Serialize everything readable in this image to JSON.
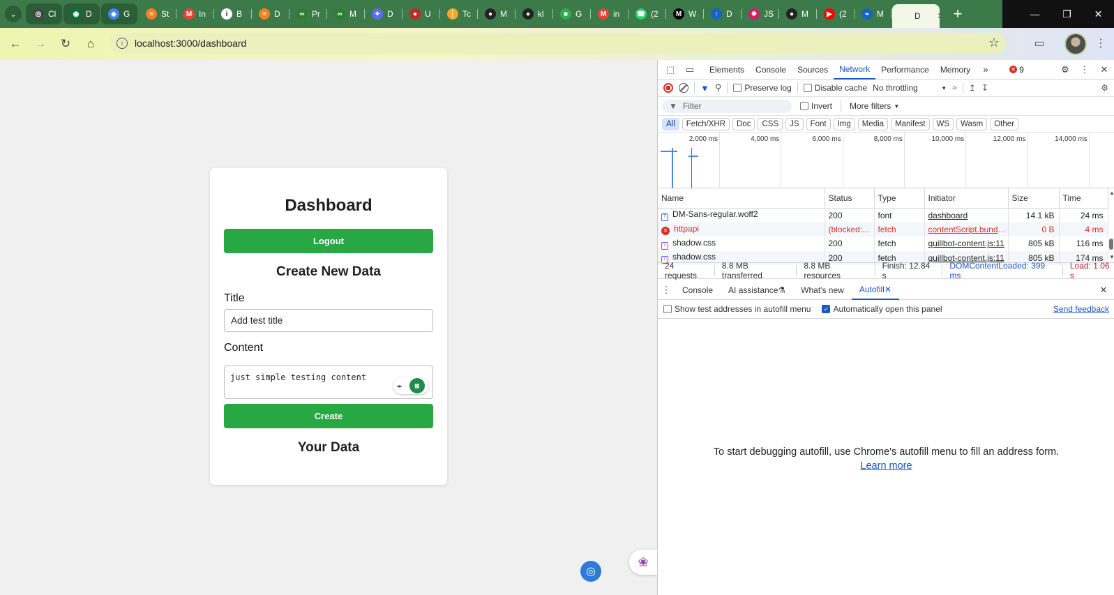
{
  "browser": {
    "tabs": [
      {
        "label": "Cl",
        "color": "#444444",
        "glyph": "◎",
        "pinned": true
      },
      {
        "label": "D",
        "color": "#0b6e3a",
        "glyph": "◉",
        "pinned": true
      },
      {
        "label": "G",
        "color": "#4285f4",
        "glyph": "◆",
        "pinned": true
      },
      {
        "label": "St",
        "color": "#f48024",
        "glyph": "≡"
      },
      {
        "label": "In",
        "color": "#ea4335",
        "glyph": "M"
      },
      {
        "label": "B",
        "color": "#ffffff",
        "glyph": "i"
      },
      {
        "label": "D",
        "color": "#f48024",
        "glyph": "≡"
      },
      {
        "label": "Pr",
        "color": "#2e7d32",
        "glyph": "∞"
      },
      {
        "label": "M",
        "color": "#2e7d32",
        "glyph": "∞"
      },
      {
        "label": "D",
        "color": "#5b6cf0",
        "glyph": "✦"
      },
      {
        "label": "U",
        "color": "#c62828",
        "glyph": "●"
      },
      {
        "label": "Tc",
        "color": "#f9a825",
        "glyph": "│"
      },
      {
        "label": "M",
        "color": "#222222",
        "glyph": "●"
      },
      {
        "label": "kl",
        "color": "#222222",
        "glyph": "●"
      },
      {
        "label": "G",
        "color": "#34a853",
        "glyph": "■"
      },
      {
        "label": "in",
        "color": "#ea4335",
        "glyph": "M"
      },
      {
        "label": "(2",
        "color": "#25d366",
        "glyph": "☎"
      },
      {
        "label": "W",
        "color": "#000000",
        "glyph": "M"
      },
      {
        "label": "D",
        "color": "#1565c0",
        "glyph": "↑"
      },
      {
        "label": "JS",
        "color": "#d81b60",
        "glyph": "✸"
      },
      {
        "label": "M",
        "color": "#222222",
        "glyph": "●"
      },
      {
        "label": "(2",
        "color": "#ff0000",
        "glyph": "▶"
      },
      {
        "label": "M",
        "color": "#1565c0",
        "glyph": "⌁"
      },
      {
        "label": "D",
        "color": "#cccccc",
        "glyph": "",
        "active": true
      }
    ],
    "url": "localhost:3000/dashboard"
  },
  "page": {
    "title": "Dashboard",
    "logout_label": "Logout",
    "create_heading": "Create New Data",
    "title_label": "Title",
    "title_value": "Add test title",
    "content_label": "Content",
    "content_value": "just simple testing content",
    "create_label": "Create",
    "your_data_heading": "Your Data"
  },
  "devtools": {
    "tabs": [
      "Elements",
      "Console",
      "Sources",
      "Network",
      "Performance",
      "Memory"
    ],
    "active_tab": "Network",
    "error_count": "9",
    "toolbar": {
      "preserve_log": "Preserve log",
      "disable_cache": "Disable cache",
      "throttling": "No throttling"
    },
    "filter": {
      "placeholder": "Filter",
      "invert": "Invert",
      "more_filters": "More filters"
    },
    "type_filters": [
      "All",
      "Fetch/XHR",
      "Doc",
      "CSS",
      "JS",
      "Font",
      "Img",
      "Media",
      "Manifest",
      "WS",
      "Wasm",
      "Other"
    ],
    "timeline_ticks": [
      "2,000 ms",
      "4,000 ms",
      "6,000 ms",
      "8,000 ms",
      "10,000 ms",
      "12,000 ms",
      "14,000 ms"
    ],
    "columns": [
      "Name",
      "Status",
      "Type",
      "Initiator",
      "Size",
      "Time"
    ],
    "rows": [
      {
        "name": "DM-Sans-regular.woff2",
        "status": "200",
        "type": "font",
        "initiator": "dashboard",
        "size": "14.1 kB",
        "time": "24 ms",
        "kind": "font"
      },
      {
        "name": "httpapi",
        "status": "(blocked:...",
        "type": "fetch",
        "initiator": "contentScript.bundle.j",
        "size": "0 B",
        "time": "4 ms",
        "kind": "err"
      },
      {
        "name": "shadow.css",
        "status": "200",
        "type": "fetch",
        "initiator": "quillbot-content.js:11",
        "size": "805 kB",
        "time": "116 ms",
        "kind": "css"
      },
      {
        "name": "shadow.css",
        "status": "200",
        "type": "fetch",
        "initiator": "quillbot-content.js:11",
        "size": "805 kB",
        "time": "174 ms",
        "kind": "css"
      }
    ],
    "summary": {
      "requests": "24 requests",
      "transferred": "8.8 MB transferred",
      "resources": "8.8 MB resources",
      "finish": "Finish: 12.84 s",
      "dcl": "DOMContentLoaded: 399 ms",
      "load": "Load: 1.06 s"
    },
    "drawer": {
      "tabs": [
        "Console",
        "AI assistance",
        "What's new",
        "Autofill"
      ],
      "active_tab": "Autofill",
      "show_test_addresses": "Show test addresses in autofill menu",
      "auto_open": "Automatically open this panel",
      "send_feedback": "Send feedback",
      "message": "To start debugging autofill, use Chrome's autofill menu to fill an address form.",
      "learn_more": "Learn more"
    }
  }
}
